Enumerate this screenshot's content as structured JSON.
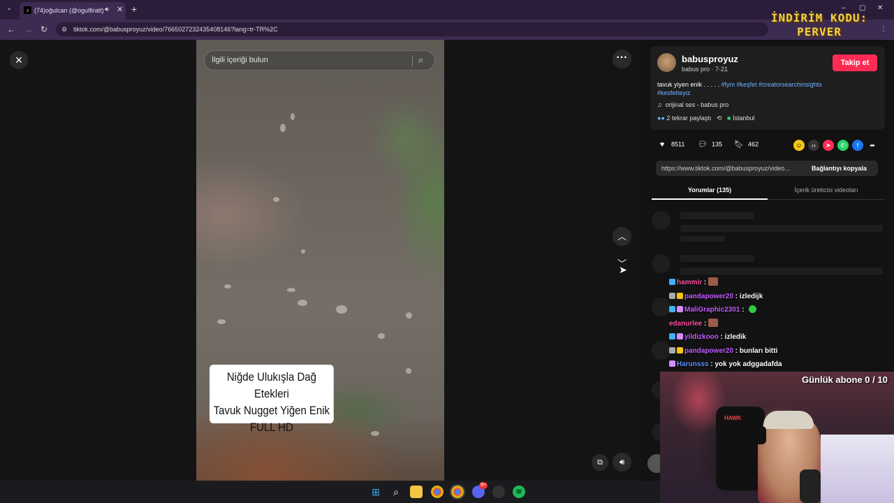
{
  "browser": {
    "tab_title": "(74)oğulcan (@ogulfiratt) |",
    "url": "tiktok.com/@babusproyuz/video/7665027232435408146?lang=tr-TR%2C",
    "promo_line1": "İNDİRİM KODU:",
    "promo_line2": "PERVER"
  },
  "video": {
    "search_placeholder": "İlgili içeriği bulun",
    "caption_lines": [
      "Niğde Ulukışla Dağ Etekleri",
      "Tavuk Nugget Yiğen Enik",
      "FULL HD"
    ]
  },
  "post": {
    "username": "babusproyuz",
    "subline": "babus pro · 7-21",
    "follow_label": "Takip et",
    "desc_text": "tavuk yiyen enik . . . . . ",
    "tags": [
      "#fym",
      "#keşfet",
      "#creatorsearchinsights",
      "#kesfetteyiz"
    ],
    "music": "orijinal ses - babus pro",
    "reposts": "2 tekrar paylaştı",
    "location": "İstanbul",
    "likes": "8511",
    "comments": "135",
    "saves": "462",
    "link": "https://www.tiktok.com/@babusproyuz/video...",
    "copy_label": "Bağlantıyı kopyala",
    "tab_comments": "Yorumlar (135)",
    "tab_creator": "İçerik üreticisi videoları"
  },
  "chat": [
    {
      "user": "hammir",
      "color": "#ff4fa3",
      "msg": ""
    },
    {
      "user": "pandapower20",
      "color": "#c45cff",
      "msg": "izledijk"
    },
    {
      "user": "MaliGraphic2301",
      "color": "#c45cff",
      "msg": ""
    },
    {
      "user": "edanurlee",
      "color": "#ff4fa3",
      "msg": ""
    },
    {
      "user": "yildizkooo",
      "color": "#c45cff",
      "msg": "izledik"
    },
    {
      "user": "pandapower20",
      "color": "#c45cff",
      "msg": "bunları bitti"
    },
    {
      "user": "Harunsss",
      "color": "#5b8dff",
      "msg": "yok yok adggadafda"
    }
  ],
  "stream": {
    "sub_counter": "Günlük abone 0 / 10",
    "chair_brand": "HAWK"
  },
  "colors": {
    "accent": "#fe2c55",
    "tag": "#6fb0ff",
    "promo": "#f2d14a"
  },
  "taskbar": {
    "discord_badge": "9+"
  }
}
